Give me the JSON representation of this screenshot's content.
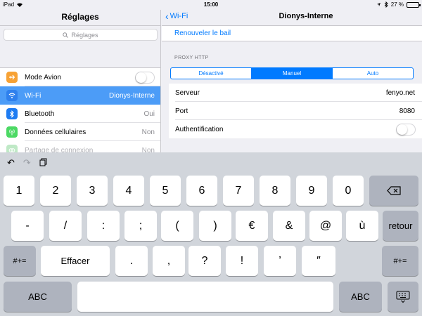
{
  "status_bar": {
    "device": "iPad",
    "time": "15:00",
    "battery_percent": "27 %",
    "battery_level": 0.27
  },
  "master": {
    "title": "Réglages",
    "search_placeholder": "Réglages",
    "items": [
      {
        "label": "Mode Avion",
        "value": "",
        "icon": "airplane-icon",
        "color": "#f7a235",
        "toggle": false
      },
      {
        "label": "Wi-Fi",
        "value": "Dionys-Interne",
        "icon": "wifi-icon",
        "color": "#2f80ed",
        "selected": true
      },
      {
        "label": "Bluetooth",
        "value": "Oui",
        "icon": "bluetooth-icon",
        "color": "#1e7cf2"
      },
      {
        "label": "Données cellulaires",
        "value": "Non",
        "icon": "cellular-antenna-icon",
        "color": "#4cd964"
      },
      {
        "label": "Partage de connexion",
        "value": "Non",
        "icon": "hotspot-icon",
        "color": "#4cd964",
        "dimmed": true
      }
    ]
  },
  "detail": {
    "back_label": "Wi-Fi",
    "title": "Dionys-Interne",
    "renew_label": "Renouveler le bail",
    "proxy_header": "PROXY HTTP",
    "segments": [
      "Désactivé",
      "Manuel",
      "Auto"
    ],
    "selected_segment": "Manuel",
    "fields": [
      {
        "label": "Serveur",
        "value": "fenyo.net"
      },
      {
        "label": "Port",
        "value": "8080"
      },
      {
        "label": "Authentification",
        "value": "",
        "toggle": false
      }
    ]
  },
  "keyboard": {
    "row1": [
      "1",
      "2",
      "3",
      "4",
      "5",
      "6",
      "7",
      "8",
      "9",
      "0"
    ],
    "row2": [
      "-",
      "/",
      ":",
      ";",
      "(",
      ")",
      "€",
      "&",
      "@",
      "ù"
    ],
    "row3": [
      "Effacer",
      ".",
      ",",
      "?",
      "!",
      "’",
      "″"
    ],
    "shift_label": "#+=",
    "return_label": "retour",
    "abc_label": "ABC",
    "accent_color": "#007aff"
  }
}
